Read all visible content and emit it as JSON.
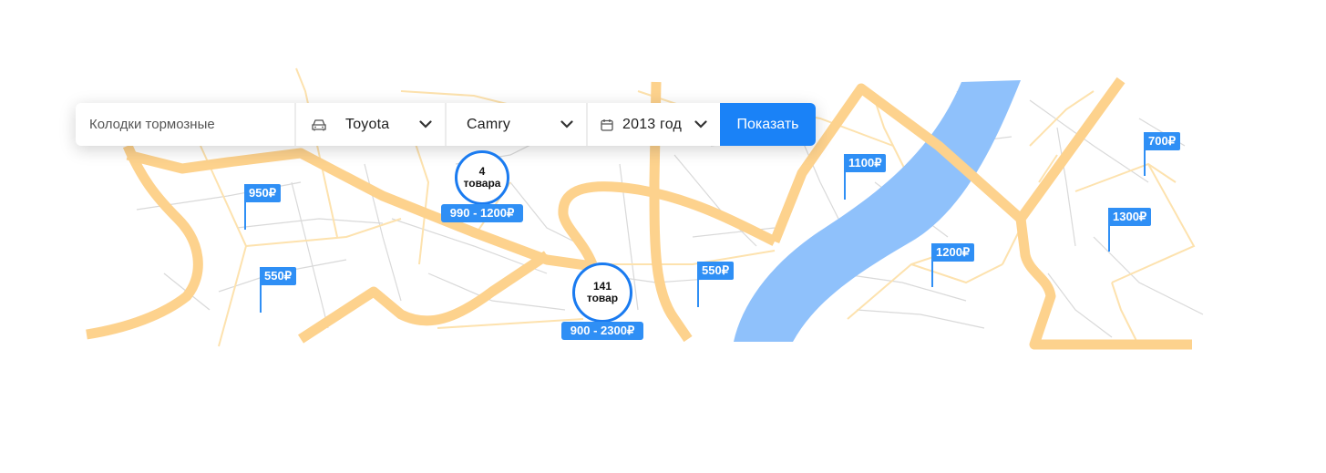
{
  "search": {
    "query": "Колодки тормозные",
    "make": "Toyota",
    "model": "Camry",
    "year": "2013 год",
    "submit_label": "Показать"
  },
  "icons": {
    "make": "car-icon",
    "year": "calendar-icon",
    "dropdown": "chevron-down-icon"
  },
  "colors": {
    "accent": "#1a82f7",
    "road": "#fdd28d",
    "river": "#8fc1fb",
    "street": "#d9d9d9",
    "marker": "#2f8ff5"
  },
  "markers": {
    "price_flags": [
      "950₽",
      "550₽",
      "550₽",
      "1100₽",
      "1200₽",
      "700₽",
      "1300₽"
    ],
    "clusters": [
      {
        "count": "4",
        "unit": "товара",
        "range": "990 - 1200₽"
      },
      {
        "count": "141",
        "unit": "товар",
        "range": "900 - 2300₽"
      }
    ]
  }
}
